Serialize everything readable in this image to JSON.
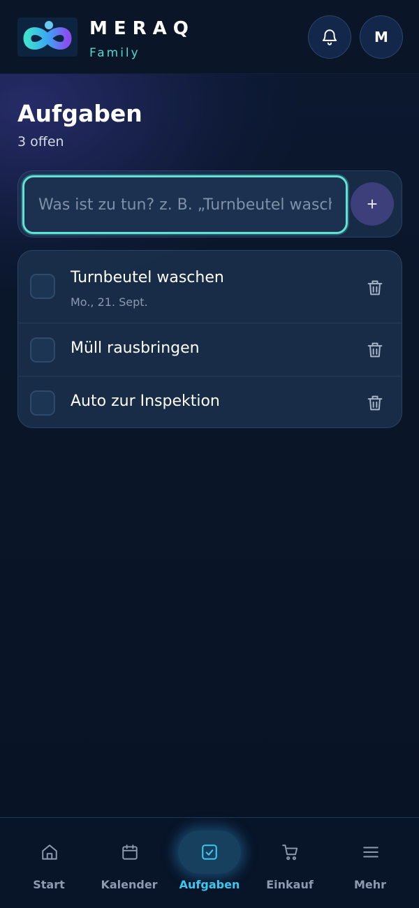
{
  "header": {
    "brand_name": "MERAQ",
    "brand_sub": "Family",
    "avatar_initial": "M"
  },
  "page": {
    "title": "Aufgaben",
    "open_count": "3 offen"
  },
  "add_task": {
    "placeholder": "Was ist zu tun? z. B. „Turnbeutel waschen“",
    "value": "",
    "add_label": "+"
  },
  "tasks": [
    {
      "title": "Turnbeutel waschen",
      "due": "Mo., 21. Sept.",
      "done": false
    },
    {
      "title": "Müll rausbringen",
      "due": "",
      "done": false
    },
    {
      "title": "Auto zur Inspektion",
      "due": "",
      "done": false
    }
  ],
  "nav": {
    "items": [
      {
        "label": "Start",
        "icon": "home-icon"
      },
      {
        "label": "Kalender",
        "icon": "calendar-icon"
      },
      {
        "label": "Aufgaben",
        "icon": "check-square-icon",
        "active": true
      },
      {
        "label": "Einkauf",
        "icon": "cart-icon"
      },
      {
        "label": "Mehr",
        "icon": "menu-icon"
      }
    ]
  },
  "colors": {
    "accent_teal": "#5fe3d3",
    "active_nav": "#3cc8f0",
    "background": "#0a1526"
  }
}
